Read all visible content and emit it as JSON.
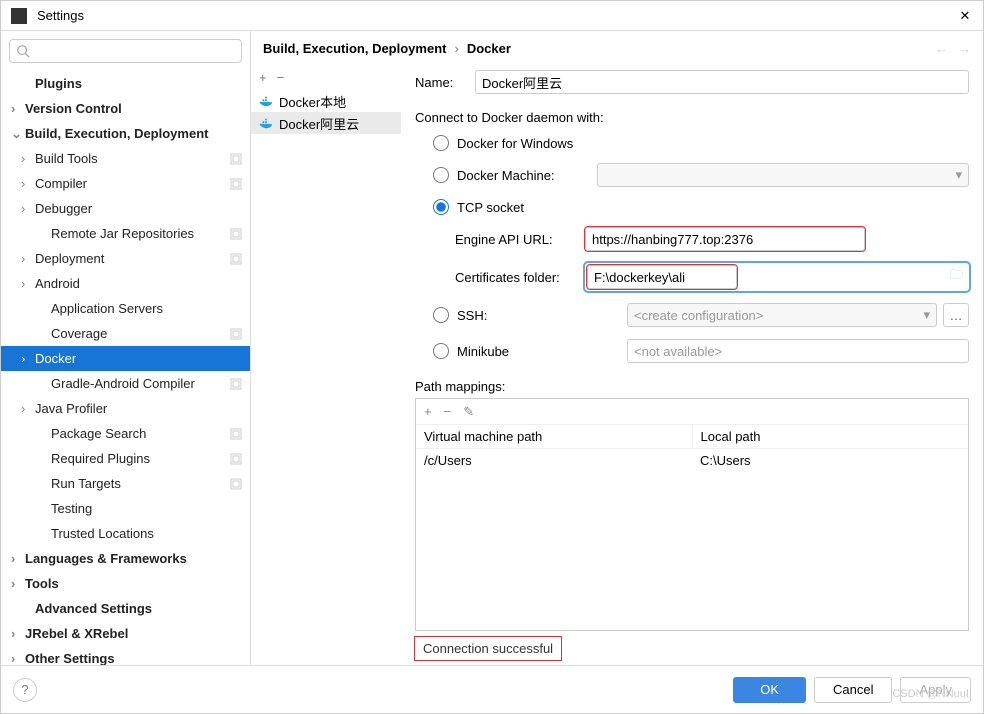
{
  "window": {
    "title": "Settings"
  },
  "breadcrumb": {
    "a": "Build, Execution, Deployment",
    "b": "Docker"
  },
  "sidebar": {
    "items": [
      {
        "label": "Plugins",
        "bold": true,
        "level": 1
      },
      {
        "label": "Version Control",
        "bold": true,
        "level": 0,
        "chev": "›"
      },
      {
        "label": "Build, Execution, Deployment",
        "bold": true,
        "level": 0,
        "chev": "⌄"
      },
      {
        "label": "Build Tools",
        "level": 1,
        "chev": "›",
        "bm": true
      },
      {
        "label": "Compiler",
        "level": 1,
        "chev": "›",
        "bm": true
      },
      {
        "label": "Debugger",
        "level": 1,
        "chev": "›"
      },
      {
        "label": "Remote Jar Repositories",
        "level": 2,
        "bm": true
      },
      {
        "label": "Deployment",
        "level": 1,
        "chev": "›",
        "bm": true
      },
      {
        "label": "Android",
        "level": 1,
        "chev": "›"
      },
      {
        "label": "Application Servers",
        "level": 2
      },
      {
        "label": "Coverage",
        "level": 2,
        "bm": true
      },
      {
        "label": "Docker",
        "level": 1,
        "chev": "›",
        "selected": true
      },
      {
        "label": "Gradle-Android Compiler",
        "level": 2,
        "bm": true
      },
      {
        "label": "Java Profiler",
        "level": 1,
        "chev": "›"
      },
      {
        "label": "Package Search",
        "level": 2,
        "bm": true
      },
      {
        "label": "Required Plugins",
        "level": 2,
        "bm": true
      },
      {
        "label": "Run Targets",
        "level": 2,
        "bm": true
      },
      {
        "label": "Testing",
        "level": 2
      },
      {
        "label": "Trusted Locations",
        "level": 2
      },
      {
        "label": "Languages & Frameworks",
        "bold": true,
        "level": 0,
        "chev": "›"
      },
      {
        "label": "Tools",
        "bold": true,
        "level": 0,
        "chev": "›"
      },
      {
        "label": "Advanced Settings",
        "bold": true,
        "level": 1
      },
      {
        "label": "JRebel & XRebel",
        "bold": true,
        "level": 0,
        "chev": "›"
      },
      {
        "label": "Other Settings",
        "bold": true,
        "level": 0,
        "chev": "›"
      }
    ]
  },
  "list": {
    "items": [
      "Docker本地",
      "Docker阿里云"
    ],
    "selected": 1
  },
  "form": {
    "name_label": "Name:",
    "name_value": "Docker阿里云",
    "connect_label": "Connect to Docker daemon with:",
    "opt_windows": "Docker for Windows",
    "opt_machine": "Docker Machine:",
    "opt_tcp": "TCP socket",
    "engine_label": "Engine API URL:",
    "engine_value": "https://hanbing777.top:2376",
    "cert_label": "Certificates folder:",
    "cert_value": "F:\\dockerkey\\ali",
    "opt_ssh": "SSH:",
    "ssh_placeholder": "<create configuration>",
    "opt_minikube": "Minikube",
    "minikube_placeholder": "<not available>",
    "path_label": "Path mappings:",
    "col_vm": "Virtual machine path",
    "col_local": "Local path",
    "row_vm": "/c/Users",
    "row_local": "C:\\Users",
    "status": "Connection successful"
  },
  "footer": {
    "ok": "OK",
    "cancel": "Cancel",
    "apply": "Apply"
  },
  "watermark": "CSDN @NNuuII"
}
